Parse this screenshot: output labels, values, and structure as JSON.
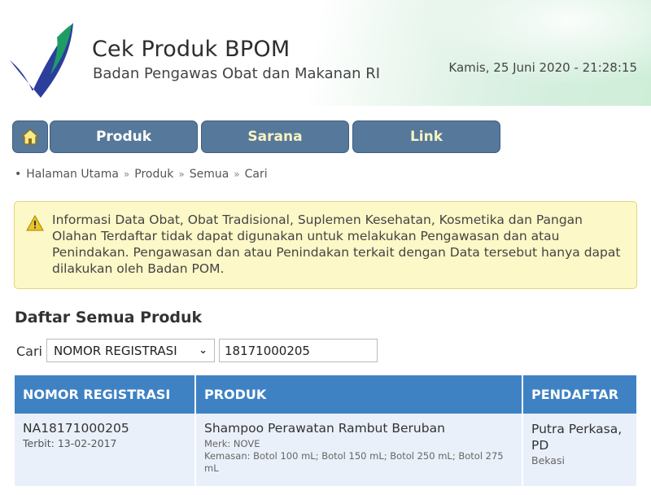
{
  "header": {
    "title": "Cek Produk BPOM",
    "subtitle": "Badan Pengawas Obat dan Makanan RI",
    "datetime": "Kamis, 25 Juni 2020 - 21:28:15",
    "logo_icon": "bpom-checkmark-logo"
  },
  "nav": {
    "home_icon": "home-icon",
    "items": [
      {
        "label": "Produk"
      },
      {
        "label": "Sarana"
      },
      {
        "label": "Link"
      }
    ]
  },
  "breadcrumb": {
    "items": [
      "Halaman Utama",
      "Produk",
      "Semua",
      "Cari"
    ]
  },
  "alert": {
    "icon": "warning-icon",
    "text": "Informasi Data Obat, Obat Tradisional, Suplemen Kesehatan, Kosmetika dan Pangan Olahan Terdaftar tidak dapat digunakan untuk melakukan Pengawasan dan atau Penindakan. Pengawasan dan atau Penindakan terkait dengan Data tersebut hanya dapat dilakukan oleh Badan POM."
  },
  "section": {
    "title": "Daftar Semua Produk"
  },
  "search": {
    "label": "Cari",
    "selected_option": "NOMOR REGISTRASI",
    "value": "18171000205"
  },
  "table": {
    "headers": [
      "NOMOR REGISTRASI",
      "PRODUK",
      "PENDAFTAR"
    ],
    "rows": [
      {
        "reg_no": "NA18171000205",
        "reg_date": "Terbit: 13-02-2017",
        "product_name": "Shampoo Perawatan Rambut Beruban",
        "merk": "Merk: NOVE",
        "kemasan": "Kemasan: Botol 100 mL; Botol 150 mL; Botol 250 mL; Botol 275 mL",
        "registrant": "Putra Perkasa, PD",
        "city": "Bekasi"
      }
    ]
  },
  "colors": {
    "nav_bg": "#56789a",
    "table_header_bg": "#3f82c4",
    "table_row_bg": "#e9f0fa",
    "alert_bg": "#fcf8c7"
  }
}
